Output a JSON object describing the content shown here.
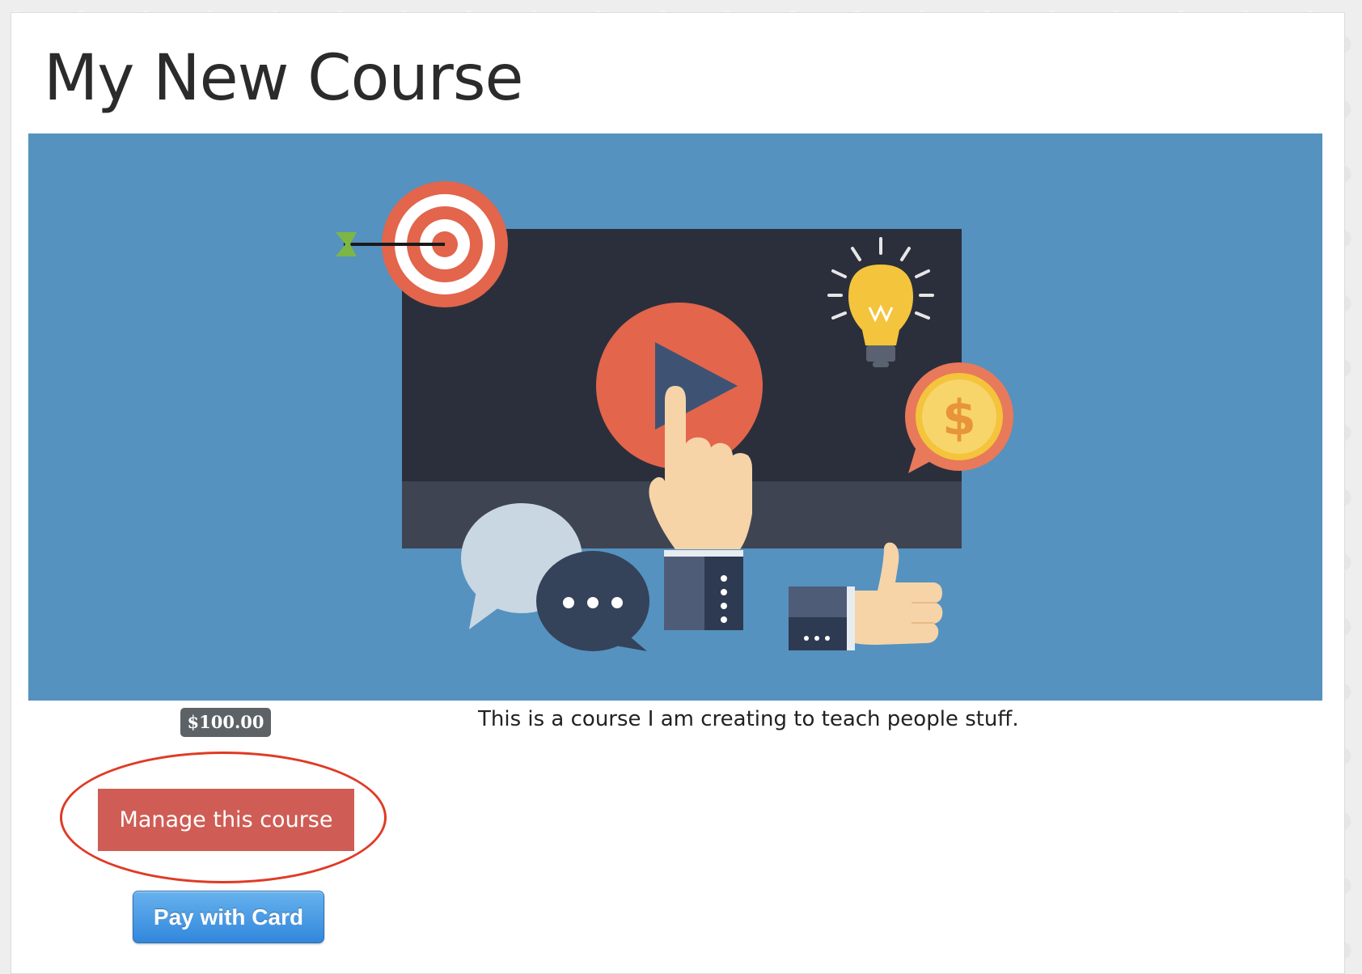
{
  "course": {
    "title": "My New Course",
    "price": "$100.00",
    "description": "This is a course I am creating to teach people stuff."
  },
  "buttons": {
    "manage_label": "Manage this course",
    "pay_label": "Pay with Card"
  },
  "banner": {
    "background_color": "#5592bf",
    "icons": [
      "video-screen",
      "play-button",
      "pointing-hand",
      "target-with-arrow",
      "lightbulb",
      "dollar-coin-bubble",
      "chat-bubbles",
      "thumbs-up"
    ]
  },
  "colors": {
    "manage_button": "#cf5d55",
    "pay_button": "#3287dc",
    "price_badge": "#5c6266",
    "highlight_ring": "#e03a25"
  }
}
